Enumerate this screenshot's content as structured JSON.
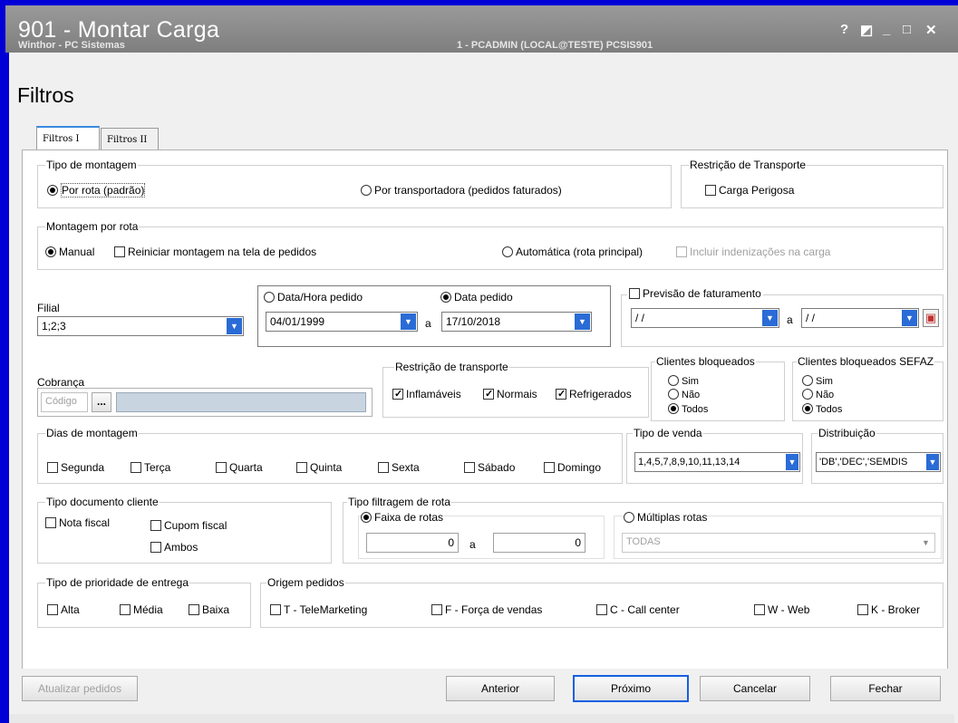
{
  "window": {
    "title": "901 - Montar Carga",
    "subtitle": "Winthor - PC Sistemas",
    "user_info": "1 - PCADMIN (LOCAL@TESTE)   PCSIS901",
    "controls": [
      "?",
      "◩",
      "_",
      "□",
      "✕"
    ]
  },
  "page_title": "Filtros",
  "tabs": [
    {
      "label": "Filtros I",
      "active": true
    },
    {
      "label": "Filtros II",
      "active": false
    }
  ],
  "tipo_montagem": {
    "title": "Tipo de montagem",
    "option_rota": "Por rota (padrão)",
    "option_transportadora": "Por transportadora (pedidos faturados)"
  },
  "restricao_transporte_top": {
    "title": "Restrição de Transporte",
    "carga_perigosa": "Carga Perigosa"
  },
  "montagem_por_rota": {
    "title": "Montagem por rota",
    "manual": "Manual",
    "reiniciar": "Reiniciar montagem na tela de pedidos",
    "automatica": "Automática (rota principal)",
    "incluir_indenizacoes": "Incluir indenizações na carga"
  },
  "filial": {
    "label": "Filial",
    "value": "1;2;3"
  },
  "datas": {
    "data_hora_pedido": "Data/Hora pedido",
    "data_pedido": "Data pedido",
    "from": "04/01/1999",
    "a": "a",
    "to": "17/10/2018"
  },
  "previsao": {
    "label": "Previsão de faturamento",
    "from": "/ /",
    "a": "a",
    "to": "/ /"
  },
  "cobranca": {
    "label": "Cobrança",
    "placeholder": "Código",
    "button": "..."
  },
  "restricao_transporte": {
    "title": "Restrição de transporte",
    "inflamaveis": "Inflamáveis",
    "normais": "Normais",
    "refrigerados": "Refrigerados"
  },
  "clientes_bloqueados": {
    "title": "Clientes bloqueados",
    "sim": "Sim",
    "nao": "Não",
    "todos": "Todos"
  },
  "clientes_bloqueados_sefaz": {
    "title": "Clientes bloqueados SEFAZ",
    "sim": "Sim",
    "nao": "Não",
    "todos": "Todos"
  },
  "dias_montagem": {
    "title": "Dias de montagem",
    "days": [
      "Segunda",
      "Terça",
      "Quarta",
      "Quinta",
      "Sexta",
      "Sábado",
      "Domingo"
    ]
  },
  "tipo_venda": {
    "title": "Tipo de venda",
    "value": "1,4,5,7,8,9,10,11,13,14"
  },
  "distribuicao": {
    "title": "Distribuição",
    "value": "'DB','DEC','SEMDIS"
  },
  "tipo_documento": {
    "title": "Tipo documento cliente",
    "nota_fiscal": "Nota fiscal",
    "cupom_fiscal": "Cupom fiscal",
    "ambos": "Ambos"
  },
  "tipo_filtragem": {
    "title": "Tipo filtragem de rota",
    "faixa": "Faixa de rotas",
    "from": "0",
    "a": "a",
    "to": "0",
    "multiplas": "Múltiplas rotas",
    "multiplas_value": "TODAS"
  },
  "prioridade": {
    "title": "Tipo de prioridade  de  entrega",
    "alta": "Alta",
    "media": "Média",
    "baixa": "Baixa"
  },
  "origem": {
    "title": "Origem pedidos",
    "telemarketing": "T - TeleMarketing",
    "forca_vendas": "F - Força de vendas",
    "call_center": "C - Call center",
    "web": "W - Web",
    "broker": "K - Broker"
  },
  "buttons": {
    "atualizar": "Atualizar pedidos",
    "anterior": "Anterior",
    "proximo": "Próximo",
    "cancelar": "Cancelar",
    "fechar": "Fechar"
  },
  "colors": {
    "accent": "#1560e0",
    "combo_arrow": "#2a6bd6",
    "titlebar": "#8a8a8a"
  }
}
